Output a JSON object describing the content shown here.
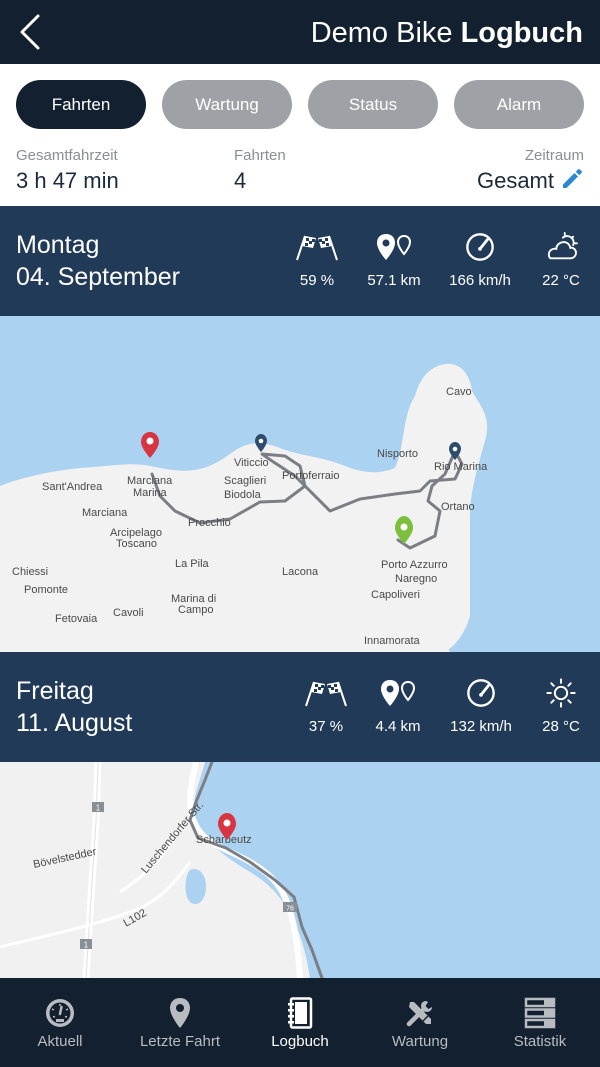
{
  "header": {
    "title_light": "Demo Bike",
    "title_bold": "Logbuch"
  },
  "tabs": [
    {
      "label": "Fahrten",
      "active": true
    },
    {
      "label": "Wartung",
      "active": false
    },
    {
      "label": "Status",
      "active": false
    },
    {
      "label": "Alarm",
      "active": false
    }
  ],
  "summary": {
    "total_time": {
      "label": "Gesamtfahrzeit",
      "value": "3 h 47 min"
    },
    "trips": {
      "label": "Fahrten",
      "value": "4"
    },
    "period": {
      "label": "Zeitraum",
      "value": "Gesamt"
    }
  },
  "days": [
    {
      "weekday": "Montag",
      "date": "04. September",
      "stats": {
        "score": "59 %",
        "distance": "57.1 km",
        "speed": "166 km/h",
        "temp": "22 °C"
      },
      "weather_icon": "cloud-sun-icon",
      "map_labels": [
        "Cavo",
        "Viticcio",
        "Nisporto",
        "Rio Marina",
        "Scaglieri",
        "Biodola",
        "Portoferraio",
        "Marciana Marina",
        "Sant'Andrea",
        "Marciana",
        "Procchio",
        "Arcipelago Toscano",
        "Ortano",
        "Porto Azzurro",
        "Naregno",
        "Capoliveri",
        "La Pila",
        "Lacona",
        "Chiessi",
        "Pomonte",
        "Marina di Campo",
        "Cavoli",
        "Fetovaia",
        "Innamorata"
      ]
    },
    {
      "weekday": "Freitag",
      "date": "11. August",
      "stats": {
        "score": "37 %",
        "distance": "4.4 km",
        "speed": "132 km/h",
        "temp": "28 °C"
      },
      "weather_icon": "sun-icon",
      "map_labels": [
        "Scharbeutz",
        "Bövelstedder",
        "Luschendorfer Str.",
        "L102",
        "1",
        "76"
      ]
    }
  ],
  "nav": [
    {
      "label": "Aktuell",
      "icon": "gauge-icon",
      "active": false
    },
    {
      "label": "Letzte Fahrt",
      "icon": "map-pin-icon",
      "active": false
    },
    {
      "label": "Logbuch",
      "icon": "notebook-icon",
      "active": true
    },
    {
      "label": "Wartung",
      "icon": "tools-icon",
      "active": false
    },
    {
      "label": "Statistik",
      "icon": "list-icon",
      "active": false
    }
  ],
  "colors": {
    "header": "#12202f",
    "banner": "#213a58",
    "tab_inactive": "#9ea2a6",
    "water": "#abd2f0",
    "land": "#f2f2f2",
    "route": "#7b7f85",
    "pin_red": "#d63541",
    "pin_green": "#7cbf3e",
    "pin_blue": "#2d4c6e",
    "edit_blue": "#2a87d8"
  }
}
